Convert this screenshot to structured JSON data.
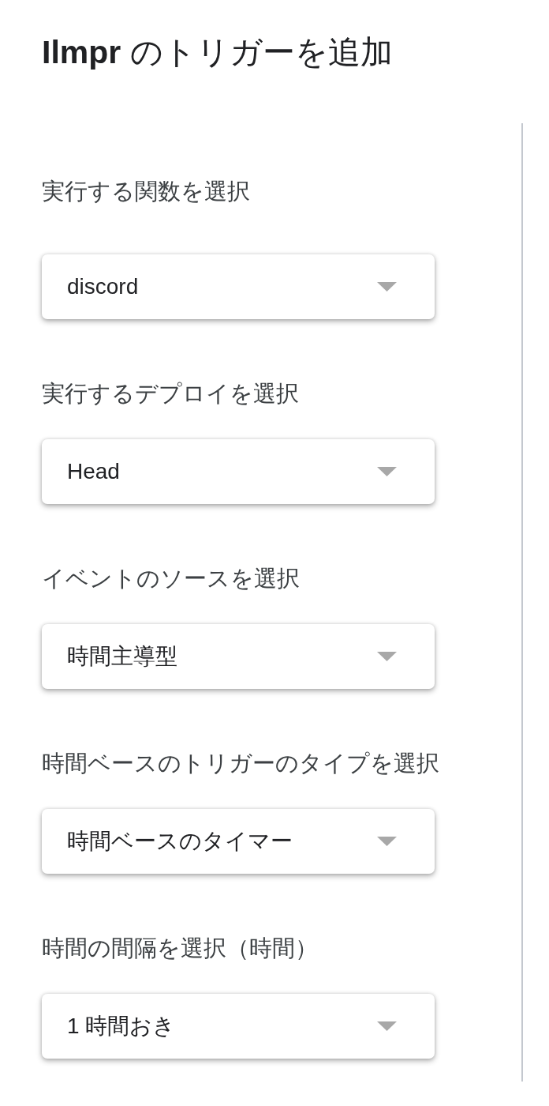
{
  "title": "**Ilmpr** のトリガーを追加",
  "fields": [
    {
      "label": "実行する関数を選択",
      "value": "discord"
    },
    {
      "label": "実行するデプロイを選択",
      "value": "Head"
    },
    {
      "label": "イベントのソースを選択",
      "value": "時間主導型"
    },
    {
      "label": "時間ベースのトリガーのタイプを選択",
      "value": "時間ベースのタイマー"
    },
    {
      "label": "時間の間隔を選択（時間）",
      "value": "1 時間おき"
    }
  ]
}
